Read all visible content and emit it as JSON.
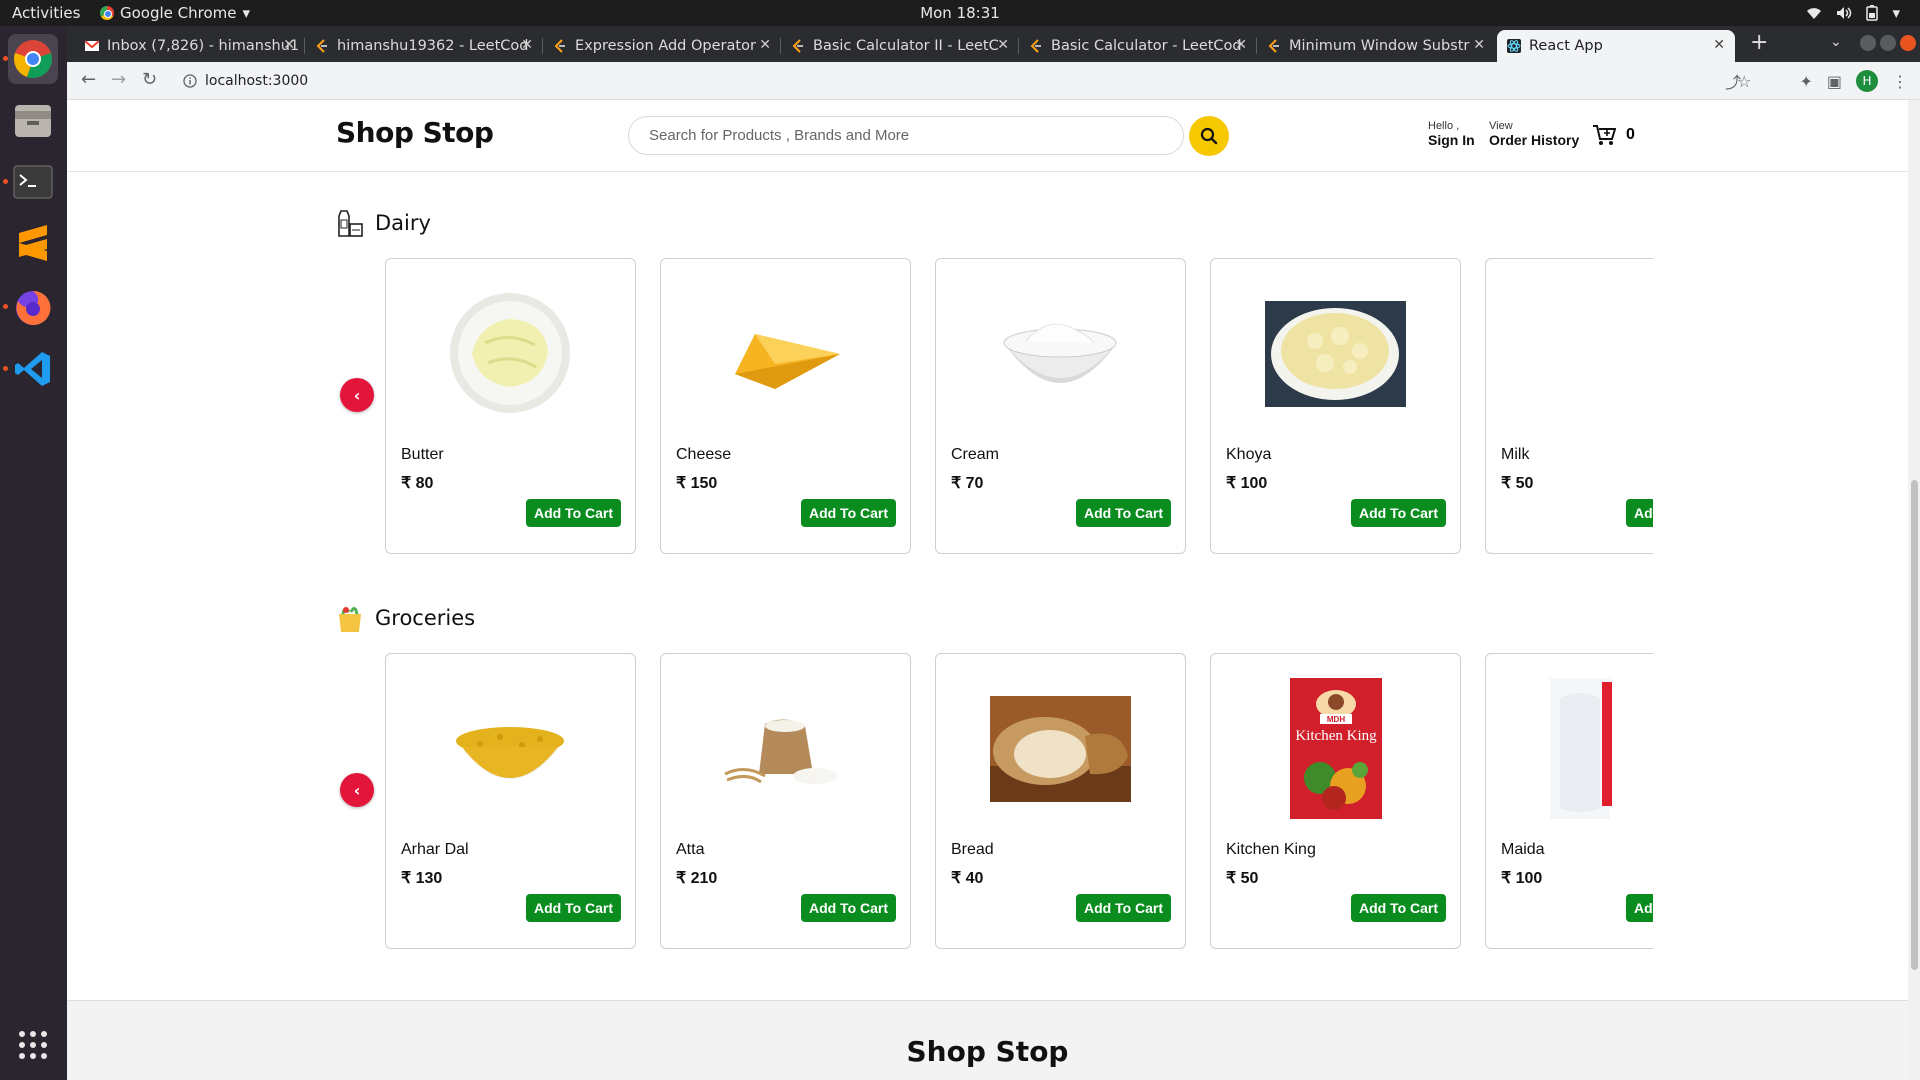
{
  "os": {
    "activities": "Activities",
    "app_name": "Google Chrome",
    "clock": "Mon 18:31"
  },
  "browser": {
    "tabs": [
      {
        "label": "Inbox (7,826) - himanshu1"
      },
      {
        "label": "himanshu19362 - LeetCod"
      },
      {
        "label": "Expression Add Operator"
      },
      {
        "label": "Basic Calculator II - LeetC"
      },
      {
        "label": "Basic Calculator - LeetCod"
      },
      {
        "label": "Minimum Window Substr"
      },
      {
        "label": "React App"
      }
    ],
    "url": "localhost:3000"
  },
  "header": {
    "logo": "Shop Stop",
    "search_placeholder": "Search for Products , Brands and More",
    "hello": "Hello ,",
    "sign_in": "Sign In",
    "view": "View",
    "order_history": "Order History",
    "cart_count": "0"
  },
  "sections": [
    {
      "title": "Dairy",
      "products": [
        {
          "name": "Butter",
          "price": "₹ 80",
          "button": "Add To Cart"
        },
        {
          "name": "Cheese",
          "price": "₹ 150",
          "button": "Add To Cart"
        },
        {
          "name": "Cream",
          "price": "₹ 70",
          "button": "Add To Cart"
        },
        {
          "name": "Khoya",
          "price": "₹ 100",
          "button": "Add To Cart"
        },
        {
          "name": "Milk",
          "price": "₹ 50",
          "button": "Add To Cart"
        }
      ]
    },
    {
      "title": "Groceries",
      "products": [
        {
          "name": "Arhar Dal",
          "price": "₹ 130",
          "button": "Add To Cart"
        },
        {
          "name": "Atta",
          "price": "₹ 210",
          "button": "Add To Cart"
        },
        {
          "name": "Bread",
          "price": "₹ 40",
          "button": "Add To Cart"
        },
        {
          "name": "Kitchen King",
          "price": "₹ 50",
          "button": "Add To Cart",
          "package_brand": "MDH",
          "package_text": "Kitchen King"
        },
        {
          "name": "Maida",
          "price": "₹ 100",
          "button": "Add To Cart"
        }
      ]
    }
  ],
  "footer": {
    "logo": "Shop Stop"
  },
  "colors": {
    "accent_yellow": "#f5c800",
    "arrow_red": "#e3153b",
    "button_green": "#0a8c1f"
  }
}
